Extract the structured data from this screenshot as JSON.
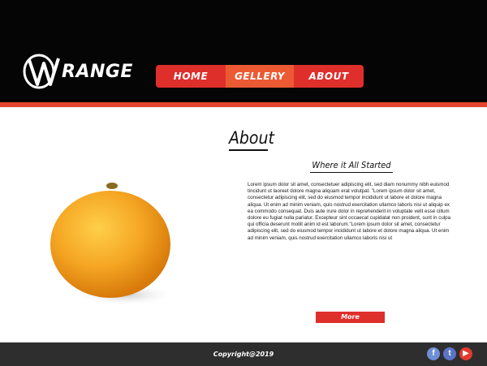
{
  "header": {
    "logo_text": "RANGE",
    "nav": {
      "home_label": "HOME",
      "gallery_label": "GELLERY",
      "about_label": "ABOUT"
    }
  },
  "main": {
    "title": "About",
    "subtitle": "Where it All Started",
    "body_text": "Lorem ipsum dolor sit amet, consectetuer adipiscing elit, sed diam nonummy nibh euismod tincidunt ut laoreet dolore magna aliquam erat volutpat. \"Lorem ipsum dolor sit amet, consectetur adipiscing elit, sed do eiusmod tempor incididunt ut labore et dolore magna aliqua. Ut enim ad minim veniam, quis nostrud exercitation ullamco laboris nisi ut aliquip ex ea commodo consequat. Duis aute irure dolor in reprehenderit in voluptate velit esse cillum dolore eu fugiat nulla pariatur. Excepteur sint occaecat cupidatat non proident, sunt in culpa qui officia deserunt mollit anim id est laborum.\"Lorem ipsum dolor sit amet, consectetur adipiscing elit, sed do eiusmod tempor incididunt ut labore et dolore magna aliqua. Ut enim ad minim veniam, quis nostrud exercitation ullamco laboris nisi ut",
    "more_label": "More"
  },
  "footer": {
    "copyright": "Copyright@2019",
    "social": {
      "facebook_glyph": "f",
      "twitter_glyph": "t",
      "youtube_glyph": "▶"
    }
  },
  "colors": {
    "header_bg": "#050505",
    "accent_red": "#df2f2b",
    "accent_orange": "#ec5a33",
    "footer_bg": "#2e2e2e"
  }
}
